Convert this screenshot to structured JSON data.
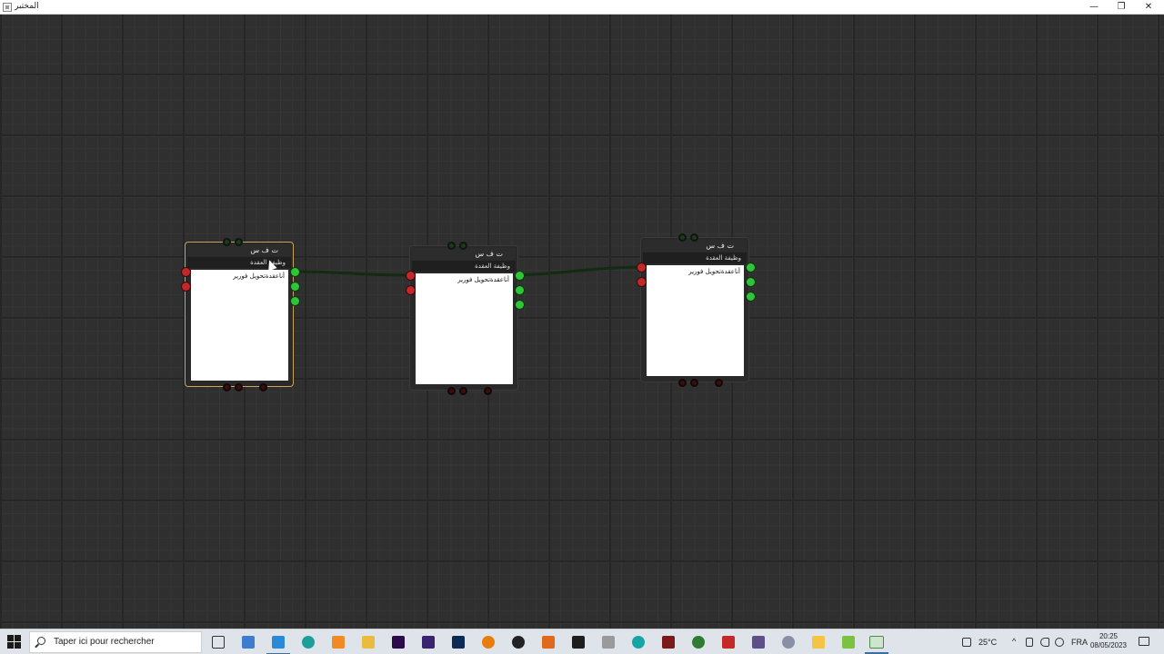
{
  "window": {
    "title": "المختبر",
    "icon": "app-window-icon",
    "controls": {
      "minimize": "—",
      "maximize": "❐",
      "close": "✕"
    }
  },
  "canvas": {
    "background_color": "#2f2f2f",
    "wire_color": "#132a13",
    "nodes": [
      {
        "id": "node-1",
        "title": "ت ف س",
        "subtitle": "وظيفة العقدة",
        "body_text": "أناعقدةتحويل فورير",
        "selected": true
      },
      {
        "id": "node-2",
        "title": "ت ف س",
        "subtitle": "وظيفة العقدة",
        "body_text": "أناعقدةتحويل فورير",
        "selected": false
      },
      {
        "id": "node-3",
        "title": "ت ف س",
        "subtitle": "وظيفة العقدة",
        "body_text": "أناعقدةتحويل فورير",
        "selected": false
      }
    ],
    "connections": [
      {
        "from": "node-1.out-1",
        "to": "node-2.in-1"
      },
      {
        "from": "node-2.out-1",
        "to": "node-3.in-1"
      }
    ],
    "port_colors": {
      "input": "#c0282a",
      "output": "#2fc43a"
    }
  },
  "taskbar": {
    "search_placeholder": "Taper ici pour rechercher",
    "apps": [
      "task-view-icon",
      "file-explorer-icon",
      "vscode-icon",
      "edge-icon",
      "sublime-text-icon",
      "folder-icon",
      "premiere-pro-icon",
      "visual-studio-icon",
      "photoshop-icon",
      "blender-icon",
      "obs-icon",
      "brackets-icon",
      "terminal-icon",
      "wb-icon",
      "arduino-icon",
      "jetbrains-icon",
      "inkscape-icon",
      "solidworks-icon",
      "app-icon",
      "game-icon",
      "notes-icon",
      "green-app-icon",
      "active-window-icon"
    ],
    "weather": "25°C",
    "language": "FRA",
    "time": "20:25",
    "date": "08/05/2023"
  }
}
